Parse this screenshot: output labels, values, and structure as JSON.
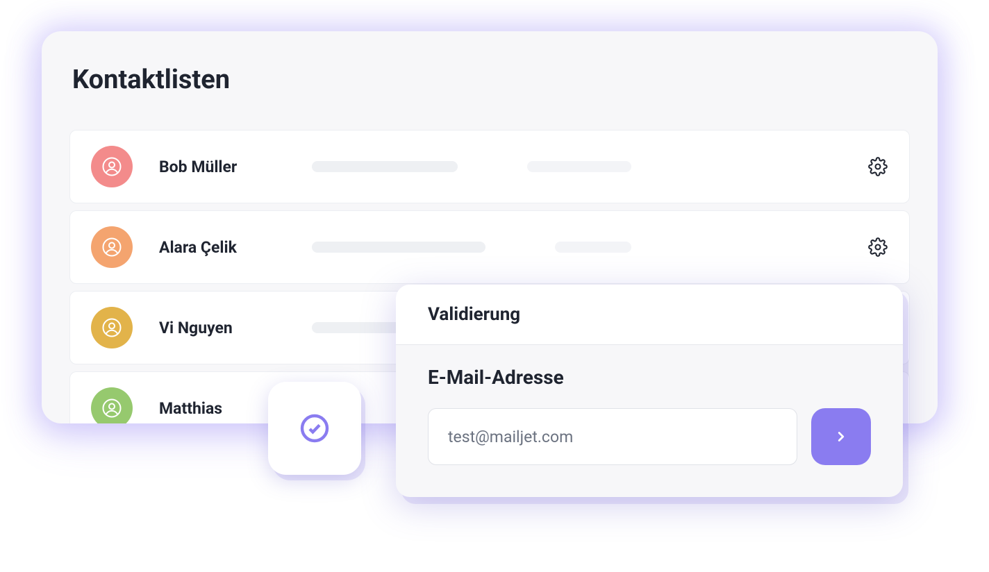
{
  "header": {
    "title": "Kontaktlisten"
  },
  "contacts": [
    {
      "name": "Bob Müller",
      "avatar_color": "#f38b8b",
      "skeleton1_w": 210,
      "skeleton2_w": 150
    },
    {
      "name": "Alara Çelik",
      "avatar_color": "#f4a46f",
      "skeleton1_w": 250,
      "skeleton2_w": 110
    },
    {
      "name": "Vi Nguyen",
      "avatar_color": "#e2b34a",
      "skeleton1_w": 130,
      "skeleton2_w": 0
    },
    {
      "name": "Matthias",
      "avatar_color": "#96c96e",
      "skeleton1_w": 0,
      "skeleton2_w": 0
    }
  ],
  "popup": {
    "title": "Validierung",
    "label": "E-Mail-Adresse",
    "email_value": "test@mailjet.com"
  },
  "icons": {
    "gear": "gear-icon",
    "user": "user-circle-icon",
    "check": "check-circle-icon",
    "chevron_right": "chevron-right-icon"
  },
  "colors": {
    "accent": "#8a7cf0"
  }
}
